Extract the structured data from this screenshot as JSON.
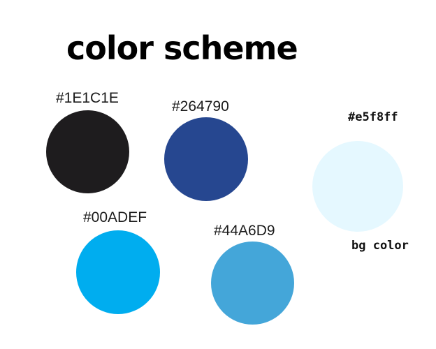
{
  "title": "color scheme",
  "swatches": [
    {
      "label": "#1E1C1E",
      "color": "#1E1C1E"
    },
    {
      "label": "#264790",
      "color": "#264790"
    },
    {
      "label": "#e5f8ff",
      "color": "#e5f8ff"
    },
    {
      "label": "#00ADEF",
      "color": "#00ADEF"
    },
    {
      "label": "#44A6D9",
      "color": "#44A6D9"
    }
  ],
  "bg_caption": "bg color"
}
